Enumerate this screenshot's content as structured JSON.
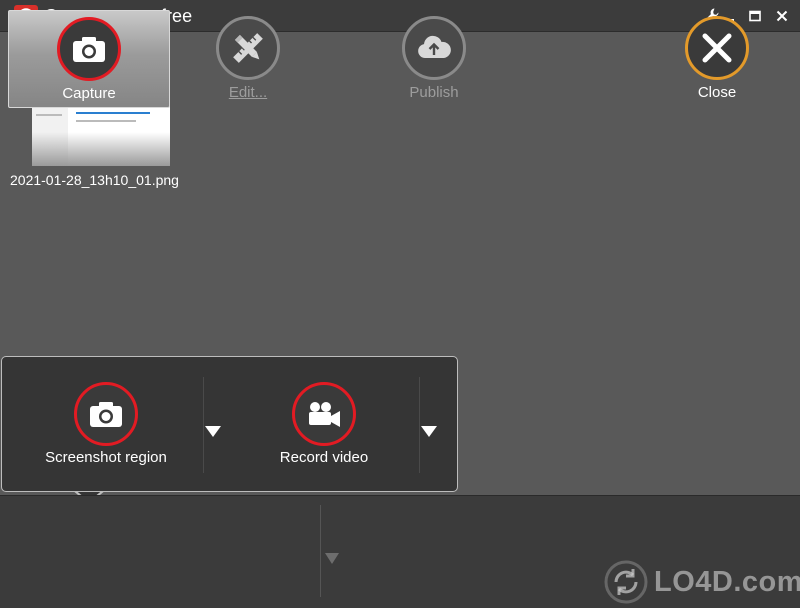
{
  "window": {
    "title": "Screenpresso free"
  },
  "workspace": {
    "thumbnails": [
      {
        "filename": "2021-01-28_13h10_01.png"
      }
    ]
  },
  "capture_popup": {
    "items": [
      {
        "label": "Screenshot region",
        "icon": "camera-icon"
      },
      {
        "label": "Record video",
        "icon": "video-camera-icon"
      }
    ]
  },
  "toolbar": {
    "capture_label": "Capture",
    "edit_label": "Edit...",
    "publish_label": "Publish",
    "close_label": "Close"
  },
  "watermark": {
    "text": "LO4D.com"
  },
  "colors": {
    "accent_red": "#e21b23",
    "close_orange": "#e39a2a",
    "background": "#595959",
    "panel": "#3b3b3b"
  }
}
